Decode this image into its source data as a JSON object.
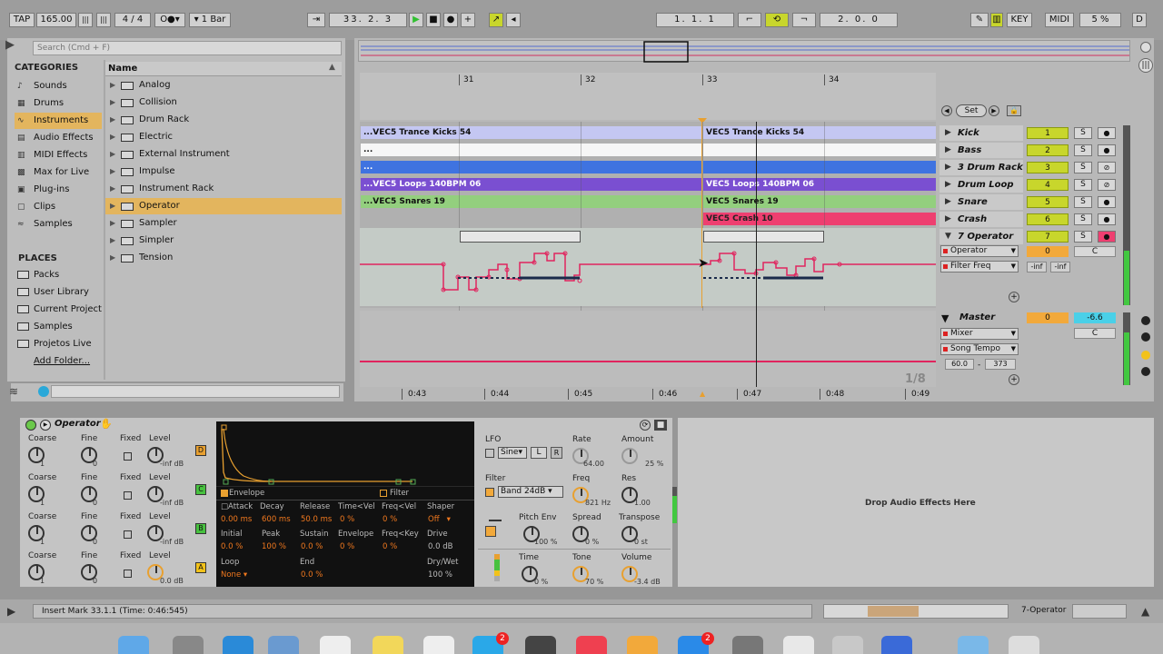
{
  "transport": {
    "tap": "TAP",
    "tempo": "165.00",
    "time_sig_num": "4",
    "time_sig_den": "4",
    "quantize": "1 Bar",
    "position": [
      "33",
      "2",
      "3"
    ],
    "loop_start": [
      "1",
      "1",
      "1"
    ],
    "loop_length": [
      "2",
      "0",
      "0"
    ],
    "key": "KEY",
    "midi": "MIDI",
    "cpu": "5 %",
    "d": "D"
  },
  "browser": {
    "search_placeholder": "Search (Cmd + F)",
    "categories_title": "CATEGORIES",
    "categories": [
      {
        "label": "Sounds",
        "icon": "speaker-note-icon",
        "selected": false
      },
      {
        "label": "Drums",
        "icon": "drum-grid-icon",
        "selected": false
      },
      {
        "label": "Instruments",
        "icon": "instrument-wave-icon",
        "selected": true
      },
      {
        "label": "Audio Effects",
        "icon": "audio-fx-icon",
        "selected": false
      },
      {
        "label": "MIDI Effects",
        "icon": "midi-fx-icon",
        "selected": false
      },
      {
        "label": "Max for Live",
        "icon": "max-icon",
        "selected": false
      },
      {
        "label": "Plug-ins",
        "icon": "plugin-icon",
        "selected": false
      },
      {
        "label": "Clips",
        "icon": "clip-icon",
        "selected": false
      },
      {
        "label": "Samples",
        "icon": "sample-wave-icon",
        "selected": false
      }
    ],
    "places_title": "PLACES",
    "places": [
      "Packs",
      "User Library",
      "Current Project",
      "Samples",
      "Projetos Live",
      "Add Folder..."
    ],
    "name_header": "Name",
    "items": [
      {
        "label": "Analog",
        "selected": false
      },
      {
        "label": "Collision",
        "selected": false
      },
      {
        "label": "Drum Rack",
        "selected": false
      },
      {
        "label": "Electric",
        "selected": false
      },
      {
        "label": "External Instrument",
        "selected": false
      },
      {
        "label": "Impulse",
        "selected": false
      },
      {
        "label": "Instrument Rack",
        "selected": false
      },
      {
        "label": "Operator",
        "selected": true
      },
      {
        "label": "Sampler",
        "selected": false
      },
      {
        "label": "Simpler",
        "selected": false
      },
      {
        "label": "Tension",
        "selected": false
      }
    ]
  },
  "arrangement": {
    "bar_markers": [
      "31",
      "32",
      "33",
      "34"
    ],
    "set_label": "Set",
    "time_markers": [
      "0:43",
      "0:44",
      "0:45",
      "0:46",
      "0:47",
      "0:48",
      "0:49"
    ],
    "zoom_ratio": "1/8",
    "clips": [
      {
        "track": "kick",
        "left": "...VEC5 Trance Kicks 54",
        "right": "VEC5 Trance Kicks 54"
      },
      {
        "track": "bass",
        "left": "...",
        "right": ""
      },
      {
        "track": "drum-rack",
        "left": "...",
        "right": ""
      },
      {
        "track": "drum-loop",
        "left": "...VEC5 Loops 140BPM 06",
        "right": "VEC5 Loops 140BPM 06"
      },
      {
        "track": "snare",
        "left": "...VEC5 Snares 19",
        "right": "VEC5 Snares 19"
      },
      {
        "track": "crash",
        "left": "",
        "right": "VEC5 Crash 10"
      }
    ],
    "tracks": [
      {
        "name": "Kick",
        "num": "1"
      },
      {
        "name": "Bass",
        "num": "2"
      },
      {
        "name": "3 Drum Rack",
        "num": "3"
      },
      {
        "name": "Drum Loop",
        "num": "4"
      },
      {
        "name": "Snare",
        "num": "5"
      },
      {
        "name": "Crash",
        "num": "6"
      },
      {
        "name": "7 Operator",
        "num": "7"
      }
    ],
    "operator_track": {
      "device_select": "Operator",
      "param_select": "Filter Freq",
      "send_a": "0",
      "pan": "C",
      "inf1": "-inf",
      "inf2": "-inf"
    },
    "master": {
      "name": "Master",
      "send": "0",
      "volume": "-6.6",
      "pan": "C",
      "mixer": "Mixer",
      "song_tempo": "Song Tempo",
      "tempo_min": "60.0",
      "tempo_max": "373"
    },
    "solo_label": "S"
  },
  "device": {
    "name": "Operator",
    "oscillators": [
      {
        "letter": "D",
        "coarse": "1",
        "fine": "0",
        "level": "-inf dB",
        "color": "#e8a030"
      },
      {
        "letter": "C",
        "coarse": "1",
        "fine": "0",
        "level": "-inf dB",
        "color": "#47c13f"
      },
      {
        "letter": "B",
        "coarse": "1",
        "fine": "0",
        "level": "-inf dB",
        "color": "#47c13f"
      },
      {
        "letter": "A",
        "coarse": "1",
        "fine": "0",
        "level": "0.0 dB",
        "color": "#f2c21a"
      }
    ],
    "osc_labels": {
      "coarse": "Coarse",
      "fine": "Fine",
      "fixed": "Fixed",
      "level": "Level"
    },
    "envelope": {
      "envelope_label": "Envelope",
      "filter_label": "Filter",
      "attack_label": "Attack",
      "attack": "0.00 ms",
      "decay_label": "Decay",
      "decay": "600 ms",
      "release_label": "Release",
      "release": "50.0 ms",
      "timevel_label": "Time<Vel",
      "timevel": "0 %",
      "freqvel_label": "Freq<Vel",
      "freqvel": "0 %",
      "shaper_label": "Shaper",
      "shaper": "Off",
      "initial_label": "Initial",
      "initial": "0.0 %",
      "peak_label": "Peak",
      "peak": "100 %",
      "sustain_label": "Sustain",
      "sustain": "0.0 %",
      "envamt_label": "Envelope",
      "envamt": "0 %",
      "freqkey_label": "Freq<Key",
      "freqkey": "0 %",
      "drive_label": "Drive",
      "drive": "0.0 dB",
      "loop_label": "Loop",
      "loop": "None",
      "end_label": "End",
      "end": "0.0 %",
      "drywet_label": "Dry/Wet",
      "drywet": "100 %"
    },
    "lfo": {
      "label": "LFO",
      "wave": "Sine",
      "range": "L",
      "retrig": "R",
      "rate_label": "Rate",
      "rate": "64.00",
      "amount_label": "Amount",
      "amount": "25 %"
    },
    "filter": {
      "label": "Filter",
      "type": "Band 24dB",
      "freq_label": "Freq",
      "freq": "821 Hz",
      "res_label": "Res",
      "res": "1.00"
    },
    "pitch": {
      "pitchenv_label": "Pitch Env",
      "pitchenv": "100 %",
      "spread_label": "Spread",
      "spread": "0 %",
      "transpose_label": "Transpose",
      "transpose": "0 st"
    },
    "global": {
      "time_label": "Time",
      "time": "0 %",
      "tone_label": "Tone",
      "tone": "70 %",
      "volume_label": "Volume",
      "volume": "-3.4 dB"
    }
  },
  "drop_zone": "Drop Audio Effects Here",
  "status": {
    "text": "Insert Mark 33.1.1 (Time: 0:46:545)",
    "track": "7-Operator"
  },
  "colors": {
    "selected": "#e3b55e",
    "kick": "#c4c7f2",
    "drum_rack": "#3f73e0",
    "drum_loop": "#7a4fd1",
    "snare": "#93cf7e",
    "crash": "#ee3f70",
    "automation": "#e0245e",
    "track_num": "#c8d62c"
  },
  "dock": [
    "finder",
    "launchpad",
    "safari",
    "preview",
    "calendar",
    "notes",
    "reminders",
    "skype",
    "ableton",
    "music",
    "ibooks",
    "appstore",
    "sysprefs",
    "chrome",
    "itunes",
    "other",
    "downloads",
    "trash"
  ],
  "dock_badges": {
    "skype": "2",
    "appstore": "2"
  }
}
